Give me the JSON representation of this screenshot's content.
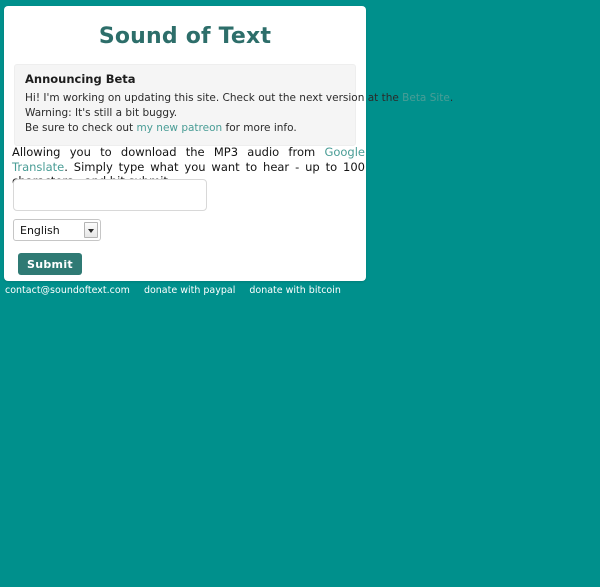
{
  "theme": {
    "background_teal": "#00908c",
    "title_teal": "#2d6e6a",
    "link_teal": "#4a9d96",
    "submit_teal": "#2f7a74",
    "alert_background": "#f5f5f5",
    "card_background": "#ffffff"
  },
  "header": {
    "title": "Sound of Text"
  },
  "alert": {
    "title": "Announcing Beta",
    "line1_prefix": "Hi! I'm working on updating this site. Check out the next version at the ",
    "line1_link": "Beta Site",
    "line1_suffix": ".",
    "line2": "Warning: It's still a bit buggy.",
    "line3_prefix": "Be sure to check out ",
    "line3_link": "my new patreon",
    "line3_suffix": " for more info."
  },
  "description": {
    "prefix": "Allowing you to download the MP3 audio from ",
    "link": "Google Translate",
    "suffix": ". Simply type what you want to hear - up to 100 characters - and hit submit."
  },
  "form": {
    "text_input_value": "",
    "text_input_placeholder": "",
    "language_selected": "English",
    "language_options": [
      "English"
    ],
    "submit_label": "Submit"
  },
  "footer": {
    "links": [
      {
        "label": "contact@soundoftext.com"
      },
      {
        "label": "donate with paypal"
      },
      {
        "label": "donate with bitcoin"
      }
    ]
  }
}
